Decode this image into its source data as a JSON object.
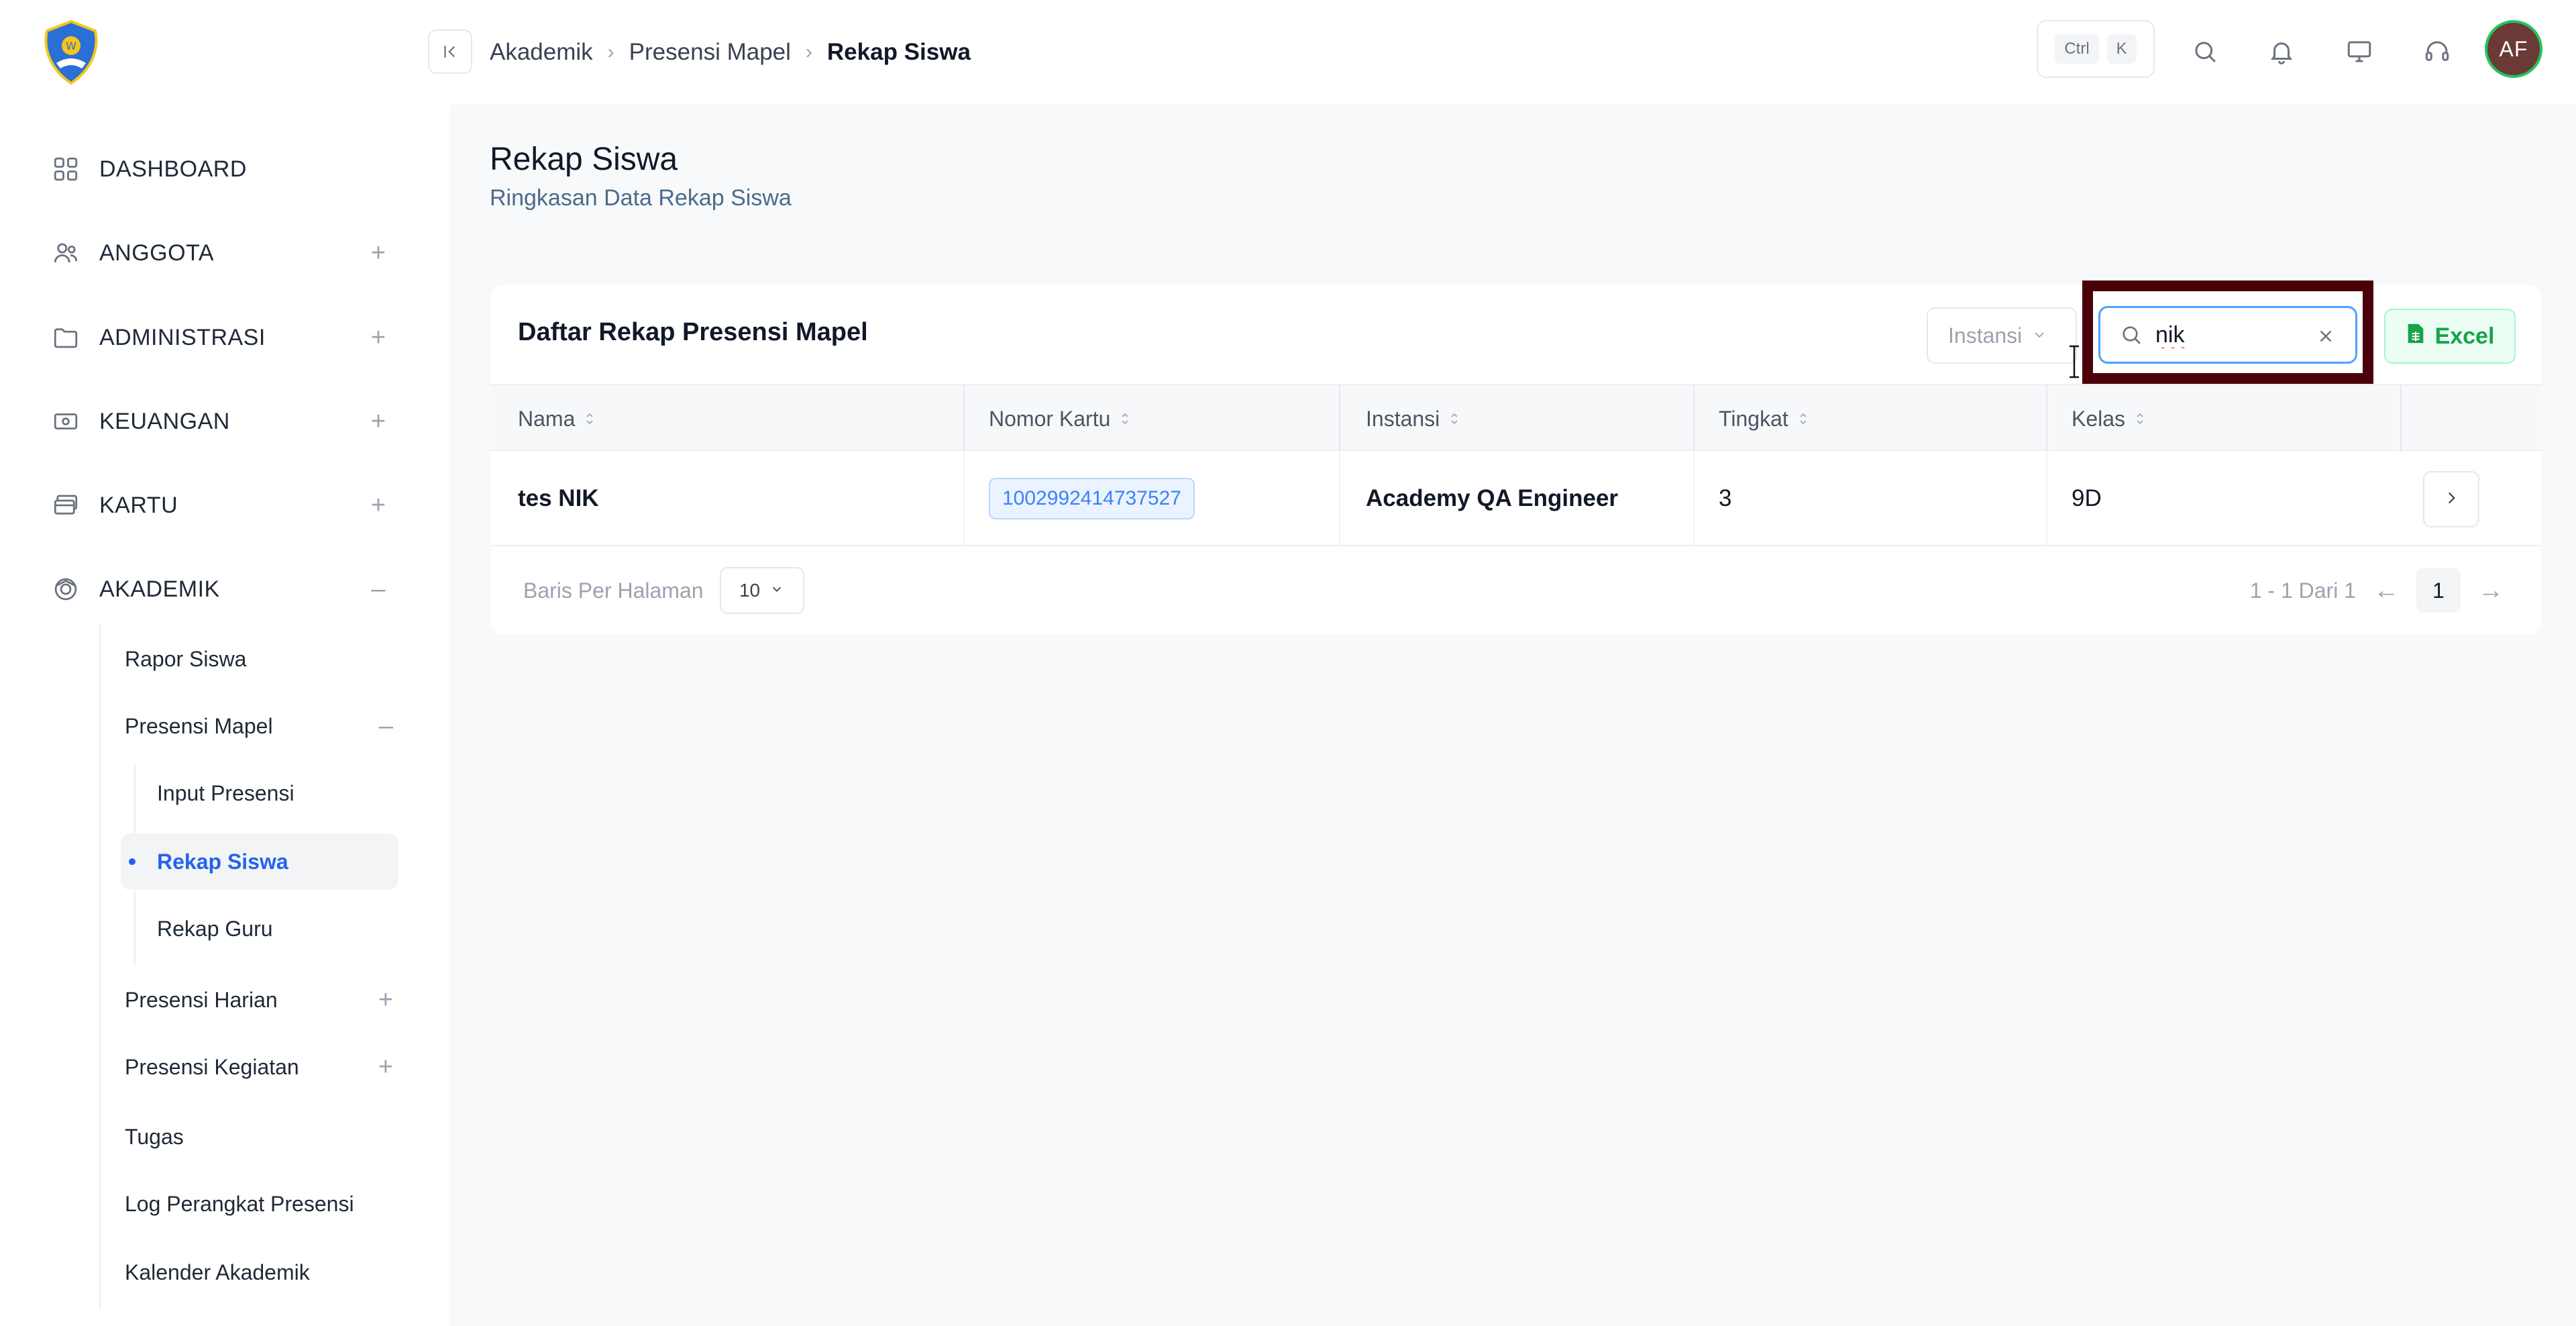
{
  "sidebar": {
    "menu": [
      {
        "label": "DASHBOARD",
        "icon": "grid-icon",
        "toggle": ""
      },
      {
        "label": "ANGGOTA",
        "icon": "users-icon",
        "toggle": "+"
      },
      {
        "label": "ADMINISTRASI",
        "icon": "folder-icon",
        "toggle": "+"
      },
      {
        "label": "KEUANGAN",
        "icon": "money-icon",
        "toggle": "+"
      },
      {
        "label": "KARTU",
        "icon": "card-icon",
        "toggle": "+"
      },
      {
        "label": "AKADEMIK",
        "icon": "academic-icon",
        "toggle": "–"
      }
    ],
    "sub": {
      "rapor": "Rapor Siswa",
      "presensi_mapel": "Presensi Mapel",
      "presensi_mapel_toggle": "–",
      "input_presensi": "Input Presensi",
      "rekap_siswa": "Rekap Siswa",
      "rekap_guru": "Rekap Guru",
      "presensi_harian": "Presensi Harian",
      "presensi_harian_toggle": "+",
      "presensi_kegiatan": "Presensi Kegiatan",
      "presensi_kegiatan_toggle": "+",
      "tugas": "Tugas",
      "log_perangkat": "Log Perangkat Presensi",
      "kalender": "Kalender Akademik"
    }
  },
  "header": {
    "breadcrumb": [
      "Akademik",
      "Presensi Mapel",
      "Rekap Siswa"
    ],
    "shortcut": [
      "Ctrl",
      "K"
    ],
    "avatar": "AF"
  },
  "page": {
    "title": "Rekap Siswa",
    "subtitle": "Ringkasan Data Rekap Siswa"
  },
  "card": {
    "title": "Daftar Rekap Presensi Mapel",
    "instansi_placeholder": "Instansi",
    "search_value": "nik",
    "excel_label": "Excel",
    "columns": [
      "Nama",
      "Nomor Kartu",
      "Instansi",
      "Tingkat",
      "Kelas"
    ],
    "rows": [
      {
        "nama": "tes NIK",
        "nomor_kartu": "1002992414737527",
        "instansi": "Academy QA Engineer",
        "tingkat": "3",
        "kelas": "9D"
      }
    ],
    "pagination": {
      "rows_label": "Baris Per Halaman",
      "page_size": "10",
      "range": "1 - 1 Dari 1",
      "current_page": "1",
      "prev": "←",
      "next": "→"
    }
  },
  "colors": {
    "accent": "#2563eb",
    "highlight_frame": "#4a0008",
    "excel": "#16a34a"
  }
}
